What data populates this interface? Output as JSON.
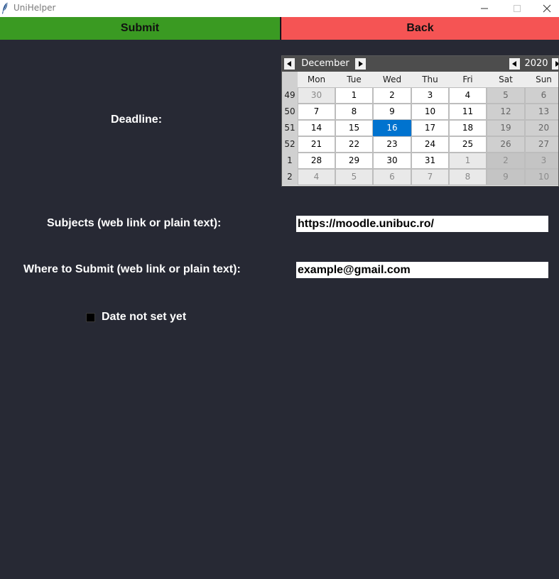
{
  "window": {
    "title": "UniHelper"
  },
  "toolbar": {
    "submit_label": "Submit",
    "back_label": "Back",
    "submit_color": "#3a9a22",
    "back_color": "#f55454"
  },
  "form": {
    "deadline_label": "Deadline:",
    "subjects_label": "Subjects (web link or plain text):",
    "subjects_value": "https://moodle.unibuc.ro/",
    "where_label": "Where to Submit (web link or plain text):",
    "where_value": "example@gmail.com",
    "date_not_set_label": "Date not set yet",
    "date_not_set_checked": false
  },
  "calendar": {
    "month": "December",
    "year": "2020",
    "selected_day": "16",
    "selected_color": "#0073cf",
    "weekdays": [
      "Mon",
      "Tue",
      "Wed",
      "Thu",
      "Fri",
      "Sat",
      "Sun"
    ],
    "weeks": [
      {
        "number": "49",
        "days": [
          {
            "d": "30",
            "other": true
          },
          {
            "d": "1"
          },
          {
            "d": "2"
          },
          {
            "d": "3"
          },
          {
            "d": "4"
          },
          {
            "d": "5"
          },
          {
            "d": "6"
          }
        ]
      },
      {
        "number": "50",
        "days": [
          {
            "d": "7"
          },
          {
            "d": "8"
          },
          {
            "d": "9"
          },
          {
            "d": "10"
          },
          {
            "d": "11"
          },
          {
            "d": "12"
          },
          {
            "d": "13"
          }
        ]
      },
      {
        "number": "51",
        "days": [
          {
            "d": "14"
          },
          {
            "d": "15"
          },
          {
            "d": "16",
            "selected": true
          },
          {
            "d": "17"
          },
          {
            "d": "18"
          },
          {
            "d": "19"
          },
          {
            "d": "20"
          }
        ]
      },
      {
        "number": "52",
        "days": [
          {
            "d": "21"
          },
          {
            "d": "22"
          },
          {
            "d": "23"
          },
          {
            "d": "24"
          },
          {
            "d": "25"
          },
          {
            "d": "26"
          },
          {
            "d": "27"
          }
        ]
      },
      {
        "number": "1",
        "days": [
          {
            "d": "28"
          },
          {
            "d": "29"
          },
          {
            "d": "30"
          },
          {
            "d": "31"
          },
          {
            "d": "1",
            "other": true
          },
          {
            "d": "2",
            "other": true
          },
          {
            "d": "3",
            "other": true
          }
        ]
      },
      {
        "number": "2",
        "days": [
          {
            "d": "4",
            "other": true
          },
          {
            "d": "5",
            "other": true
          },
          {
            "d": "6",
            "other": true
          },
          {
            "d": "7",
            "other": true
          },
          {
            "d": "8",
            "other": true
          },
          {
            "d": "9",
            "other": true
          },
          {
            "d": "10",
            "other": true
          }
        ]
      }
    ]
  }
}
